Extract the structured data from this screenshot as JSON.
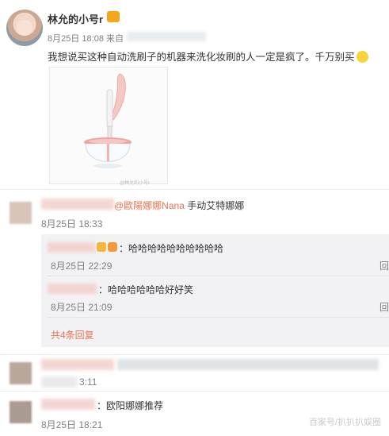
{
  "post": {
    "author": "林允的小号r",
    "date": "8月25日 18:08",
    "source_prefix": "来自",
    "text": "我想说买这种自动洗刷子的机器来洗化妆刷的人一定是疯了。千万别买"
  },
  "image": {
    "watermark": "@林允的小号r"
  },
  "comments": [
    {
      "mention": "@歐陽娜娜Nana",
      "text": " 手动艾特娜娜",
      "time": "8月25日 18:33",
      "replies": [
        {
          "text": "：哈哈哈哈哈哈哈哈哈哈",
          "time": "8月25日 22:29",
          "right": "回"
        },
        {
          "text": "：哈哈哈哈哈哈好好笑",
          "time": "8月25日 21:09",
          "right": "回"
        }
      ],
      "more_replies": "共4条回复"
    },
    {
      "time": "3:11"
    },
    {
      "text": "：欧阳娜娜推荐",
      "time": "8月25日 18:21"
    }
  ],
  "page_watermark": "百家号/扒扒扒娱圈"
}
